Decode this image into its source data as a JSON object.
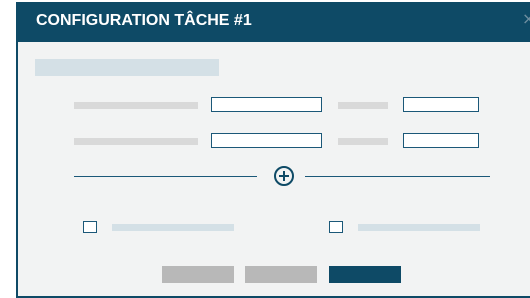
{
  "dialog": {
    "title": "CONFIGURATION TÂCHE #1",
    "close_glyph": "×"
  },
  "icons": {
    "close": "close-icon",
    "add": "plus-circle-icon"
  },
  "form": {
    "row1": {
      "field_a_value": "",
      "field_b_value": ""
    },
    "row2": {
      "field_a_value": "",
      "field_b_value": ""
    }
  },
  "options": {
    "checkbox_1_checked": false,
    "checkbox_2_checked": false
  },
  "colors": {
    "header_bg": "#0e4a66",
    "dialog_bg": "#f2f3f3",
    "placeholder_gray": "#d9d9d9",
    "placeholder_blue": "#d4e0e6",
    "button_gray": "#b8b8b8",
    "button_primary": "#0e4a66"
  }
}
